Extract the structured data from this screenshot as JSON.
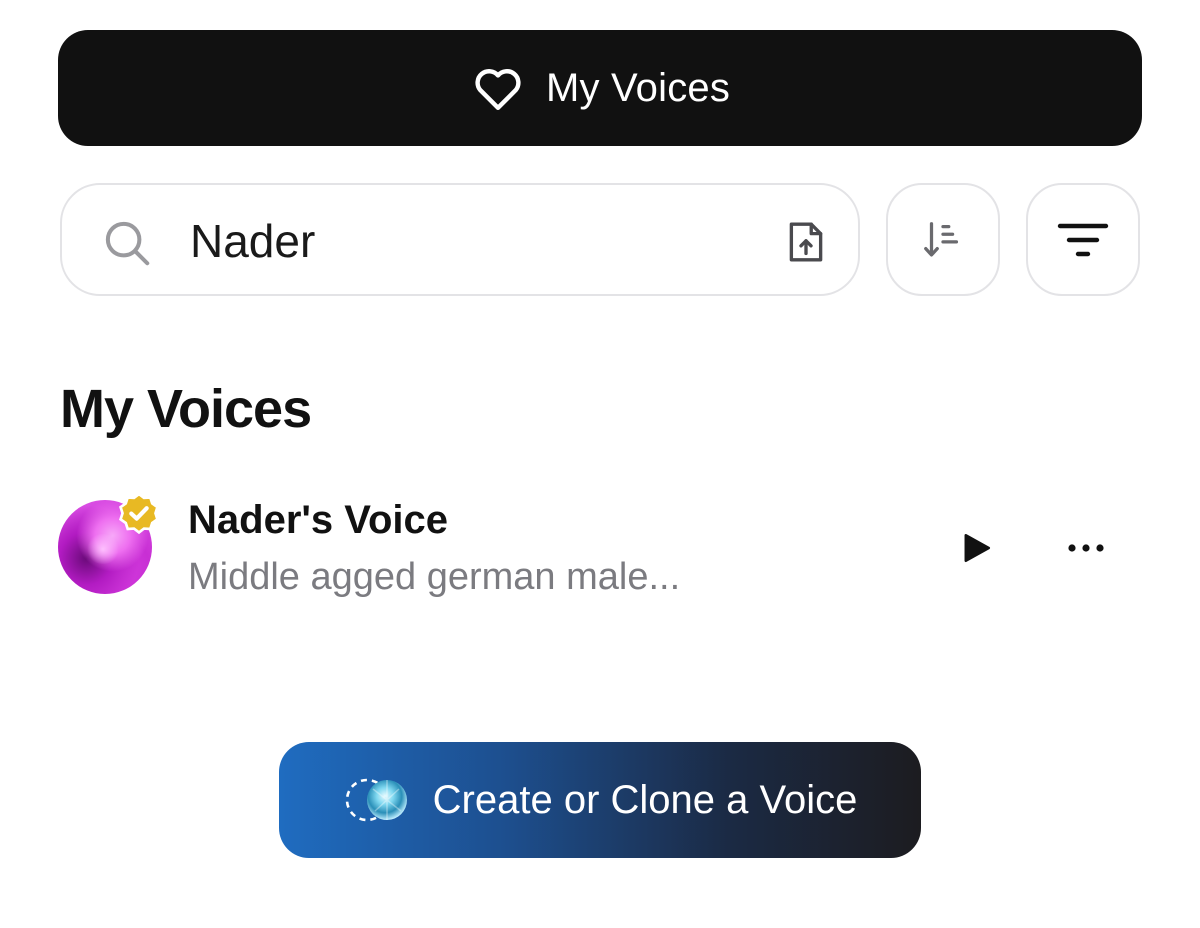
{
  "top_tab": {
    "label": "My Voices",
    "icon": "heart-icon"
  },
  "search": {
    "value": "Nader",
    "placeholder": "",
    "icon": "search-icon",
    "upload_icon": "file-upload-icon"
  },
  "toolbar": {
    "sort_icon": "sort-descending-icon",
    "filter_icon": "filter-icon"
  },
  "section": {
    "title": "My Voices"
  },
  "voices": [
    {
      "name": "Nader's Voice",
      "description": "Middle agged german male...",
      "verified": true,
      "play_icon": "play-icon",
      "more_icon": "more-horizontal-icon"
    }
  ],
  "create_button": {
    "label": "Create or Clone a Voice",
    "icon": "voice-orb-icon"
  },
  "colors": {
    "primary_dark": "#111111",
    "badge_gold": "#e8b923",
    "muted_text": "#7b7b80",
    "border": "#e3e3e6",
    "gradient_start": "#1f6cc0",
    "gradient_end": "#1c1c20"
  }
}
